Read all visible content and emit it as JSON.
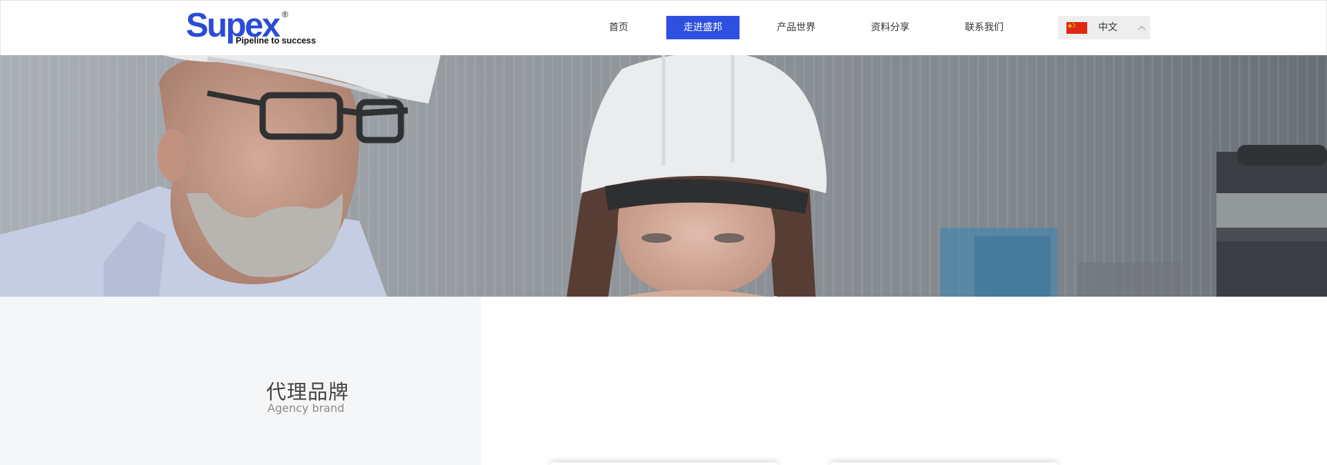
{
  "header": {
    "logo": {
      "wordmark": "Supex",
      "registered": "®",
      "tagline": "Pipeline to success"
    },
    "nav": {
      "items": [
        {
          "label": "首页",
          "active": false
        },
        {
          "label": "走进盛邦",
          "active": true
        },
        {
          "label": "产品世界",
          "active": false
        },
        {
          "label": "资料分享",
          "active": false
        },
        {
          "label": "联系我们",
          "active": false
        }
      ]
    },
    "language": {
      "label": "中文",
      "flag_icon": "china-flag-icon",
      "chevron_icon": "chevron-up-icon"
    },
    "colors": {
      "accent": "#2e4fe0",
      "logo": "#2a4cd6"
    }
  },
  "hero": {
    "image": "two-engineers-in-white-hard-hats"
  },
  "section": {
    "title": "代理品牌",
    "subtitle": "Agency brand"
  }
}
